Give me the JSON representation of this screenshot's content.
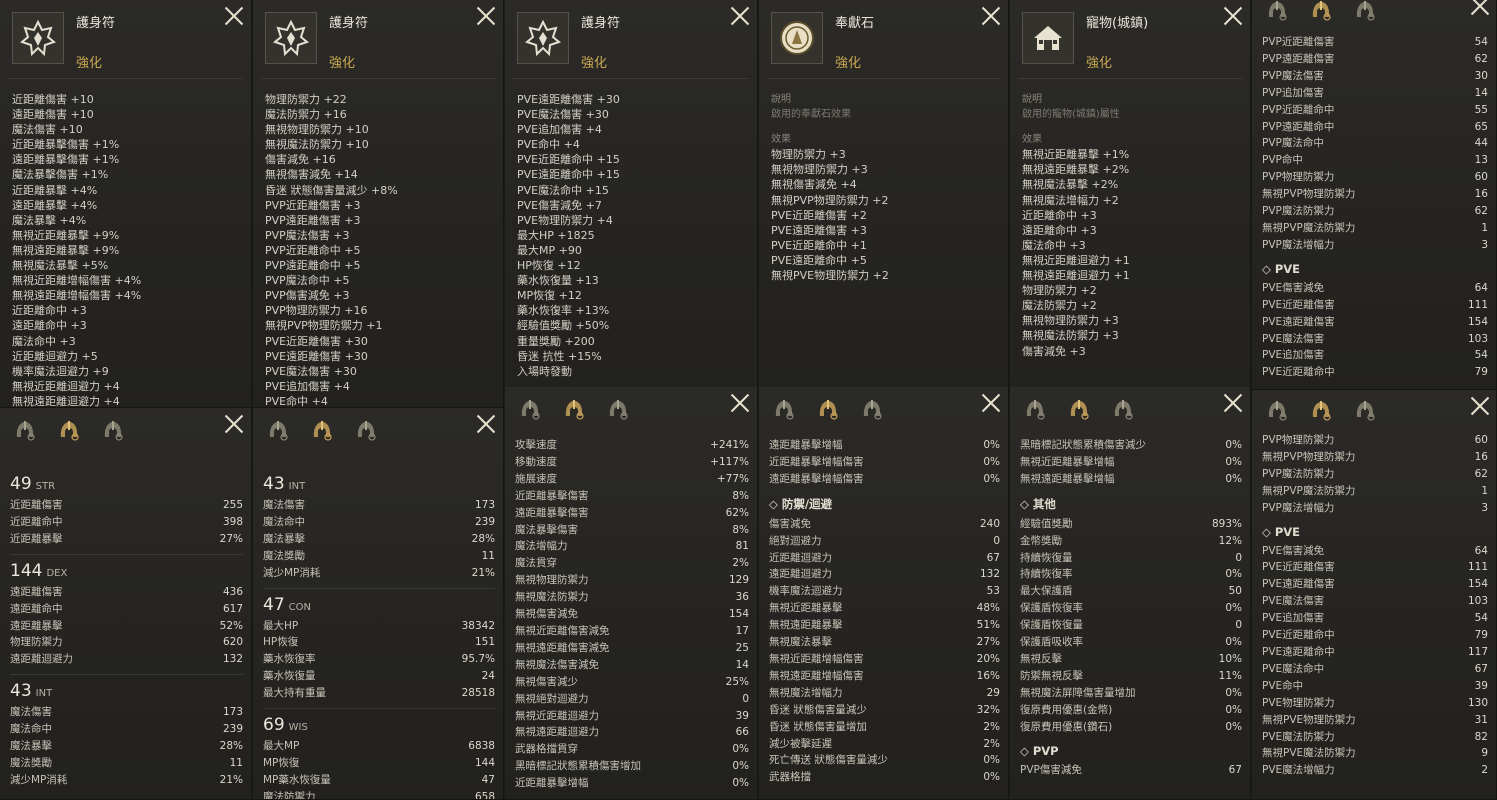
{
  "amulet_panels": [
    {
      "title": "護身符",
      "subtitle": "強化",
      "icon": "amulet-icon",
      "lines": [
        "近距離傷害 +10",
        "遠距離傷害 +10",
        "魔法傷害 +10",
        "近距離暴擊傷害 +1%",
        "遠距離暴擊傷害 +1%",
        "魔法暴擊傷害 +1%",
        "近距離暴擊 +4%",
        "遠距離暴擊 +4%",
        "魔法暴擊 +4%",
        "無視近距離暴擊 +9%",
        "無視遠距離暴擊 +9%",
        "無視魔法暴擊 +5%",
        "無視近距離增幅傷害 +4%",
        "無視遠距離增幅傷害 +4%",
        "近距離命中 +3",
        "遠距離命中 +3",
        "魔法命中 +3",
        "近距離迴避力 +5",
        "機率魔法迴避力 +9",
        "無視近距離迴避力 +4",
        "無視遠距離迴避力 +4"
      ]
    },
    {
      "title": "護身符",
      "subtitle": "強化",
      "icon": "amulet-icon",
      "lines": [
        "物理防禦力 +22",
        "魔法防禦力 +16",
        "無視物理防禦力 +10",
        "無視魔法防禦力 +10",
        "傷害減免 +16",
        "無視傷害減免 +14",
        "昏迷 狀態傷害量減少 +8%",
        "PVP近距離傷害 +3",
        "PVP遠距離傷害 +3",
        "PVP魔法傷害 +3",
        "PVP近距離命中 +5",
        "PVP遠距離命中 +5",
        "PVP魔法命中 +5",
        "PVP傷害減免 +3",
        "PVP物理防禦力 +16",
        "無視PVP物理防禦力 +1",
        "PVE近距離傷害 +30",
        "PVE遠距離傷害 +30",
        "PVE魔法傷害 +30",
        "PVE追加傷害 +4",
        "PVE命中 +4"
      ]
    },
    {
      "title": "護身符",
      "subtitle": "強化",
      "icon": "amulet-icon",
      "lines": [
        "PVE遠距離傷害 +30",
        "PVE魔法傷害 +30",
        "PVE追加傷害 +4",
        "PVE命中 +4",
        "PVE近距離命中 +15",
        "PVE遠距離命中 +15",
        "PVE魔法命中 +15",
        "PVE傷害減免 +7",
        "PVE物理防禦力 +4",
        "最大HP +1825",
        "最大MP +90",
        "HP恢復 +12",
        "藥水恢復量 +13",
        "MP恢復 +12",
        "藥水恢復率 +13%",
        "經驗值獎勵 +50%",
        "重量獎勵 +200",
        "昏迷 抗性 +15%",
        "入場時發動"
      ]
    },
    {
      "title": "奉獻石",
      "subtitle": "強化",
      "icon": "offering-stone-icon",
      "desc_label": "說明",
      "desc": "啟用的奉獻石效果",
      "effect_label": "效果",
      "lines": [
        "物理防禦力 +3",
        "無視物理防禦力 +3",
        "無視傷害減免 +4",
        "無視PVP物理防禦力 +2",
        "PVE近距離傷害 +2",
        "PVE遠距離傷害 +3",
        "PVE近距離命中 +1",
        "PVE遠距離命中 +5",
        "無視PVE物理防禦力 +2"
      ]
    },
    {
      "title": "寵物(城鎮)",
      "subtitle": "強化",
      "icon": "town-pet-icon",
      "desc_label": "說明",
      "desc": "啟用的寵物(城鎮)屬性",
      "effect_label": "效果",
      "lines": [
        "無視近距離暴擊 +1%",
        "無視遠距離暴擊 +2%",
        "無視魔法暴擊 +2%",
        "無視魔法增幅力 +2",
        "近距離命中 +3",
        "遠距離命中 +3",
        "魔法命中 +3",
        "無視近距離迴避力 +1",
        "無視遠距離迴避力 +1",
        "物理防禦力 +2",
        "魔法防禦力 +2",
        "無視物理防禦力 +3",
        "無視魔法防禦力 +3",
        "傷害減免 +3"
      ]
    }
  ],
  "stat_panels": [
    {
      "sections": [
        {
          "type": "ability",
          "value": "49",
          "name": "STR",
          "rows": [
            [
              "近距離傷害",
              "255"
            ],
            [
              "近距離命中",
              "398"
            ],
            [
              "近距離暴擊",
              "27%"
            ]
          ]
        },
        {
          "type": "ability",
          "value": "144",
          "name": "DEX",
          "rows": [
            [
              "遠距離傷害",
              "436"
            ],
            [
              "遠距離命中",
              "617"
            ],
            [
              "遠距離暴擊",
              "52%"
            ],
            [
              "物理防禦力",
              "620"
            ],
            [
              "遠距離迴避力",
              "132"
            ]
          ]
        },
        {
          "type": "ability",
          "value": "43",
          "name": "INT",
          "rows": [
            [
              "魔法傷害",
              "173"
            ],
            [
              "魔法命中",
              "239"
            ],
            [
              "魔法暴擊",
              "28%"
            ],
            [
              "魔法獎勵",
              "11"
            ],
            [
              "減少MP消耗",
              "21%"
            ]
          ]
        }
      ]
    },
    {
      "sections": [
        {
          "type": "ability",
          "value": "43",
          "name": "INT",
          "rows": [
            [
              "魔法傷害",
              "173"
            ],
            [
              "魔法命中",
              "239"
            ],
            [
              "魔法暴擊",
              "28%"
            ],
            [
              "魔法獎勵",
              "11"
            ],
            [
              "減少MP消耗",
              "21%"
            ]
          ]
        },
        {
          "type": "ability",
          "value": "47",
          "name": "CON",
          "rows": [
            [
              "最大HP",
              "38342"
            ],
            [
              "HP恢復",
              "151"
            ],
            [
              "藥水恢復率",
              "95.7%"
            ],
            [
              "藥水恢復量",
              "24"
            ],
            [
              "最大持有重量",
              "28518"
            ]
          ]
        },
        {
          "type": "ability",
          "value": "69",
          "name": "WIS",
          "rows": [
            [
              "最大MP",
              "6838"
            ],
            [
              "MP恢復",
              "144"
            ],
            [
              "MP藥水恢復量",
              "47"
            ],
            [
              "魔法防禦力",
              "658"
            ]
          ]
        }
      ]
    },
    {
      "sections": [
        {
          "type": "plain",
          "rows": [
            [
              "攻擊速度",
              "+241%"
            ],
            [
              "移動速度",
              "+117%"
            ],
            [
              "施展速度",
              "+77%"
            ],
            [
              "近距離暴擊傷害",
              "8%"
            ],
            [
              "遠距離暴擊傷害",
              "62%"
            ],
            [
              "魔法暴擊傷害",
              "8%"
            ],
            [
              "魔法增幅力",
              "81"
            ],
            [
              "魔法貫穿",
              "2%"
            ],
            [
              "無視物理防禦力",
              "129"
            ],
            [
              "無視魔法防禦力",
              "36"
            ],
            [
              "無視傷害減免",
              "154"
            ],
            [
              "無視近距離傷害減免",
              "17"
            ],
            [
              "無視遠距離傷害減免",
              "25"
            ],
            [
              "無視魔法傷害減免",
              "14"
            ],
            [
              "無視傷害減少",
              "25%"
            ],
            [
              "無視絕對迴避力",
              "0"
            ],
            [
              "無視近距離迴避力",
              "39"
            ],
            [
              "無視遠距離迴避力",
              "66"
            ],
            [
              "武器格擋貫穿",
              "0%"
            ],
            [
              "黑暗標記狀態累積傷害增加",
              "0%"
            ],
            [
              "近距離暴擊增幅",
              "0%"
            ]
          ]
        }
      ]
    },
    {
      "sections": [
        {
          "type": "plain",
          "rows": [
            [
              "遠距離暴擊增幅",
              "0%"
            ],
            [
              "近距離暴擊增幅傷害",
              "0%"
            ],
            [
              "遠距離暴擊增幅傷害",
              "0%"
            ]
          ]
        },
        {
          "type": "header",
          "title": "防禦/迴避",
          "rows": [
            [
              "傷害減免",
              "240"
            ],
            [
              "絕對迴避力",
              "0"
            ],
            [
              "近距離迴避力",
              "67"
            ],
            [
              "遠距離迴避力",
              "132"
            ],
            [
              "機率魔法迴避力",
              "53"
            ],
            [
              "無視近距離暴擊",
              "48%"
            ],
            [
              "無視遠距離暴擊",
              "51%"
            ],
            [
              "無視魔法暴擊",
              "27%"
            ],
            [
              "無視近距離增幅傷害",
              "20%"
            ],
            [
              "無視遠距離增幅傷害",
              "16%"
            ],
            [
              "無視魔法增幅力",
              "29"
            ],
            [
              "昏迷 狀態傷害量減少",
              "32%"
            ],
            [
              "昏迷 狀態傷害量增加",
              "2%"
            ],
            [
              "減少被擊延遲",
              "2%"
            ],
            [
              "死亡傳送 狀態傷害量減少",
              "0%"
            ],
            [
              "武器格擋",
              "0%"
            ]
          ]
        }
      ]
    },
    {
      "sections": [
        {
          "type": "plain",
          "rows": [
            [
              "黑暗標記狀態累積傷害減少",
              "0%"
            ],
            [
              "無視近距離暴擊增幅",
              "0%"
            ],
            [
              "無視遠距離暴擊增幅",
              "0%"
            ]
          ]
        },
        {
          "type": "header",
          "title": "其他",
          "rows": [
            [
              "經驗值獎勵",
              "893%"
            ],
            [
              "金幣獎勵",
              "12%"
            ],
            [
              "持續恢復量",
              "0"
            ],
            [
              "持續恢復率",
              "0%"
            ],
            [
              "最大保護盾",
              "50"
            ],
            [
              "保護盾恢復率",
              "0%"
            ],
            [
              "保護盾恢復量",
              "0"
            ],
            [
              "保護盾吸收率",
              "0%"
            ],
            [
              "無視反擊",
              "10%"
            ],
            [
              "防禦無視反擊",
              "11%"
            ],
            [
              "無視魔法屏障傷害量增加",
              "0%"
            ],
            [
              "復原費用優惠(金幣)",
              "0%"
            ],
            [
              "復原費用優惠(鑽石)",
              "0%"
            ]
          ]
        },
        {
          "type": "header",
          "title": "PVP",
          "rows": [
            [
              "PVP傷害減免",
              "67"
            ]
          ]
        }
      ]
    }
  ],
  "right_top": {
    "rows1": [
      [
        "PVP近距離傷害",
        "54"
      ],
      [
        "PVP遠距離傷害",
        "62"
      ],
      [
        "PVP魔法傷害",
        "30"
      ],
      [
        "PVP追加傷害",
        "14"
      ],
      [
        "PVP近距離命中",
        "55"
      ],
      [
        "PVP遠距離命中",
        "65"
      ],
      [
        "PVP魔法命中",
        "44"
      ],
      [
        "PVP命中",
        "13"
      ],
      [
        "PVP物理防禦力",
        "60"
      ],
      [
        "無視PVP物理防禦力",
        "16"
      ],
      [
        "PVP魔法防禦力",
        "62"
      ],
      [
        "無視PVP魔法防禦力",
        "1"
      ],
      [
        "PVP魔法增幅力",
        "3"
      ]
    ],
    "section": "PVE",
    "rows2": [
      [
        "PVE傷害減免",
        "64"
      ],
      [
        "PVE近距離傷害",
        "111"
      ],
      [
        "PVE遠距離傷害",
        "154"
      ],
      [
        "PVE魔法傷害",
        "103"
      ],
      [
        "PVE追加傷害",
        "54"
      ],
      [
        "PVE近距離命中",
        "79"
      ]
    ]
  },
  "right_bottom": {
    "rows1": [
      [
        "PVP物理防禦力",
        "60"
      ],
      [
        "無視PVP物理防禦力",
        "16"
      ],
      [
        "PVP魔法防禦力",
        "62"
      ],
      [
        "無視PVP魔法防禦力",
        "1"
      ],
      [
        "PVP魔法增幅力",
        "3"
      ]
    ],
    "section": "PVE",
    "rows2": [
      [
        "PVE傷害減免",
        "64"
      ],
      [
        "PVE近距離傷害",
        "111"
      ],
      [
        "PVE遠距離傷害",
        "154"
      ],
      [
        "PVE魔法傷害",
        "103"
      ],
      [
        "PVE追加傷害",
        "54"
      ],
      [
        "PVE近距離命中",
        "79"
      ],
      [
        "PVE遠距離命中",
        "117"
      ],
      [
        "PVE魔法命中",
        "67"
      ],
      [
        "PVE命中",
        "39"
      ],
      [
        "PVE物理防禦力",
        "130"
      ],
      [
        "無視PVE物理防禦力",
        "31"
      ],
      [
        "PVE魔法防禦力",
        "82"
      ],
      [
        "無視PVE魔法防禦力",
        "9"
      ],
      [
        "PVE魔法增幅力",
        "2"
      ]
    ]
  }
}
